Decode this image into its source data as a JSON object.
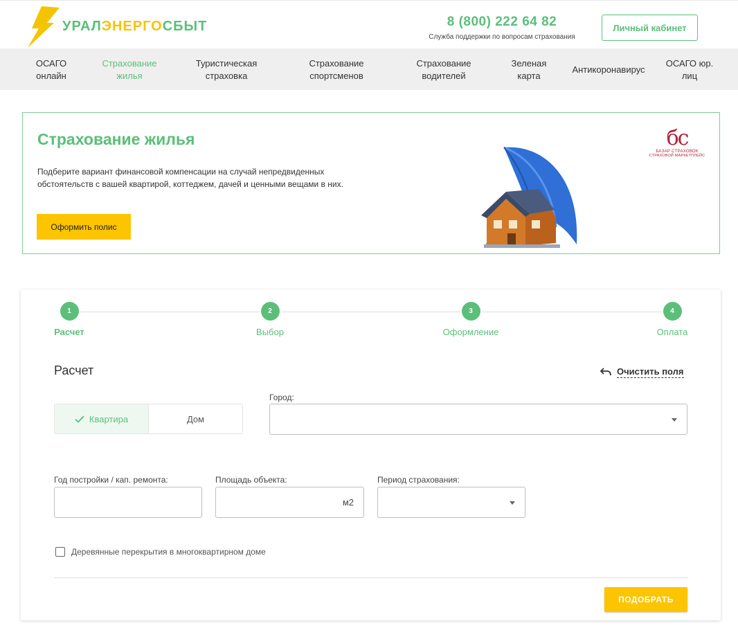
{
  "header": {
    "logo_text_a": "УРАЛ",
    "logo_text_b": "ЭНЕРГО",
    "logo_text_c": "СБЫТ",
    "phone": "8 (800) 222 64 82",
    "phone_caption": "Служба поддержки по вопросам страхования",
    "cabinet_label": "Личный кабинет"
  },
  "nav": {
    "items": [
      {
        "line1": "ОСАГО",
        "line2": "онлайн"
      },
      {
        "line1": "Страхование",
        "line2": "жилья"
      },
      {
        "line1": "Туристическая",
        "line2": "страховка"
      },
      {
        "line1": "Страхование",
        "line2": "спортсменов"
      },
      {
        "line1": "Страхование",
        "line2": "водителей"
      },
      {
        "line1": "Зеленая",
        "line2": "карта"
      },
      {
        "line1": "Антикоронавирус",
        "line2": ""
      },
      {
        "line1": "ОСАГО юр.",
        "line2": "лиц"
      }
    ],
    "active_index": 1
  },
  "banner": {
    "title": "Страхование жилья",
    "description": "Подберите вариант финансовой компенсации на случай непредвиденных обстоятельств с вашей квартирой, коттеджем, дачей и ценными вещами в них.",
    "button_label": "Оформить полис",
    "partner_line1": "БАЗАР СТРАХОВОК",
    "partner_line2": "СТРАХОВОЙ МАРКЕТПЛЕЙС"
  },
  "steps": [
    {
      "number": "1",
      "label": "Расчет"
    },
    {
      "number": "2",
      "label": "Выбор"
    },
    {
      "number": "3",
      "label": "Оформление"
    },
    {
      "number": "4",
      "label": "Оплата"
    }
  ],
  "calculator": {
    "title": "Расчет",
    "clear_label": "Очистить поля",
    "property_type": {
      "options": [
        "Квартира",
        "Дом"
      ],
      "selected": "Квартира"
    },
    "city_label": "Город:",
    "city_value": "",
    "year_label": "Год постройки / кап. ремонта:",
    "year_value": "",
    "area_label": "Площадь объекта:",
    "area_value": "",
    "area_unit": "м2",
    "period_label": "Период страхования:",
    "period_value": "",
    "wooden_floors_label": "Деревянные перекрытия в многоквартирном доме",
    "wooden_floors_checked": false,
    "submit_label": "ПОДОБРАТЬ"
  },
  "colors": {
    "brand_green": "#5bbf7a",
    "brand_yellow": "#fdc400",
    "nav_bg": "#efefef",
    "partner_red": "#b0233a"
  },
  "icons": {
    "logo": "lightning-bolt-icon",
    "clear": "undo-arrow-icon",
    "check": "checkmark-icon",
    "dropdown": "caret-down-icon"
  }
}
